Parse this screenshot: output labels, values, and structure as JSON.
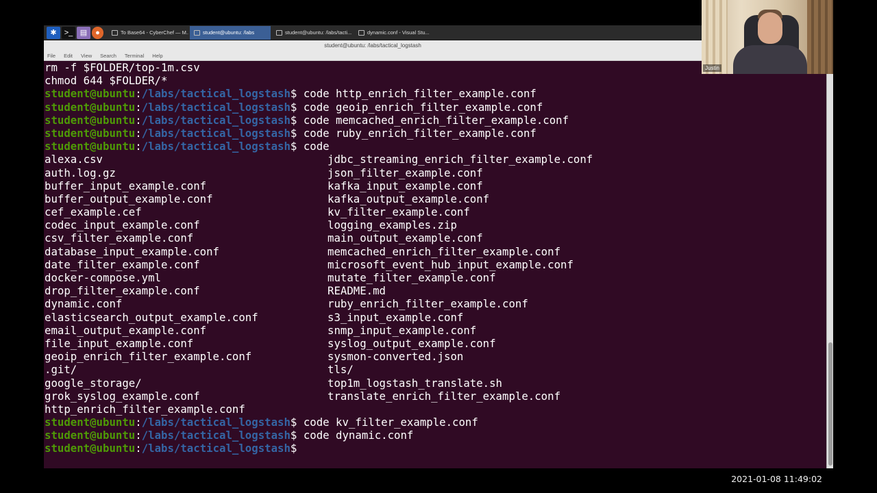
{
  "taskbar": {
    "tasks": [
      {
        "label": "To Base64 - CyberChef — M...",
        "active": false
      },
      {
        "label": "student@ubuntu: /labs",
        "active": true
      },
      {
        "label": "student@ubuntu: /labs/tacti...",
        "active": false
      },
      {
        "label": "dynamic.conf - Visual Stu...",
        "active": false
      }
    ]
  },
  "window": {
    "title": "student@ubuntu: /labs/tactical_logstash",
    "menu": [
      "File",
      "Edit",
      "View",
      "Search",
      "Terminal",
      "Help"
    ]
  },
  "terminal": {
    "prompt_user": "student@ubuntu",
    "prompt_sep": ":",
    "prompt_path": "/labs/tactical_logstash",
    "prompt_sym": "$",
    "lines": [
      {
        "type": "text",
        "text": "rm -f $FOLDER/top-1m.csv"
      },
      {
        "type": "text",
        "text": "chmod 644 $FOLDER/*"
      },
      {
        "type": "prompt",
        "cmd": " code http_enrich_filter_example.conf"
      },
      {
        "type": "prompt",
        "cmd": " code geoip_enrich_filter_example.conf"
      },
      {
        "type": "prompt",
        "cmd": " code memcached_enrich_filter_example.conf"
      },
      {
        "type": "prompt",
        "cmd": " code ruby_enrich_filter_example.conf"
      },
      {
        "type": "prompt",
        "cmd": " code"
      },
      {
        "type": "cols",
        "a": "alexa.csv",
        "b": "jdbc_streaming_enrich_filter_example.conf"
      },
      {
        "type": "cols",
        "a": "auth.log.gz",
        "b": "json_filter_example.conf"
      },
      {
        "type": "cols",
        "a": "buffer_input_example.conf",
        "b": "kafka_input_example.conf"
      },
      {
        "type": "cols",
        "a": "buffer_output_example.conf",
        "b": "kafka_output_example.conf"
      },
      {
        "type": "cols",
        "a": "cef_example.cef",
        "b": "kv_filter_example.conf"
      },
      {
        "type": "cols",
        "a": "codec_input_example.conf",
        "b": "logging_examples.zip"
      },
      {
        "type": "cols",
        "a": "csv_filter_example.conf",
        "b": "main_output_example.conf"
      },
      {
        "type": "cols",
        "a": "database_input_example.conf",
        "b": "memcached_enrich_filter_example.conf"
      },
      {
        "type": "cols",
        "a": "date_filter_example.conf",
        "b": "microsoft_event_hub_input_example.conf"
      },
      {
        "type": "cols",
        "a": "docker-compose.yml",
        "b": "mutate_filter_example.conf"
      },
      {
        "type": "cols",
        "a": "drop_filter_example.conf",
        "b": "README.md"
      },
      {
        "type": "cols",
        "a": "dynamic.conf",
        "b": "ruby_enrich_filter_example.conf"
      },
      {
        "type": "cols",
        "a": "elasticsearch_output_example.conf",
        "b": "s3_input_example.conf"
      },
      {
        "type": "cols",
        "a": "email_output_example.conf",
        "b": "snmp_input_example.conf"
      },
      {
        "type": "cols",
        "a": "file_input_example.conf",
        "b": "syslog_output_example.conf"
      },
      {
        "type": "cols",
        "a": "geoip_enrich_filter_example.conf",
        "b": "sysmon-converted.json"
      },
      {
        "type": "cols",
        "a": ".git/",
        "b": "tls/"
      },
      {
        "type": "cols",
        "a": "google_storage/",
        "b": "top1m_logstash_translate.sh"
      },
      {
        "type": "cols",
        "a": "grok_syslog_example.conf",
        "b": "translate_enrich_filter_example.conf"
      },
      {
        "type": "text",
        "text": "http_enrich_filter_example.conf"
      },
      {
        "type": "prompt",
        "cmd": " code kv_filter_example.conf"
      },
      {
        "type": "prompt",
        "cmd": " code dynamic.conf"
      },
      {
        "type": "prompt",
        "cmd": ""
      }
    ]
  },
  "webcam": {
    "name": "Justin"
  },
  "overlay": {
    "timestamp": "2021-01-08 11:49:02"
  },
  "colors": {
    "terminal_bg": "#300a24",
    "prompt_user": "#4e9a06",
    "prompt_path": "#3465a4",
    "active_task": "#3b5f95"
  }
}
